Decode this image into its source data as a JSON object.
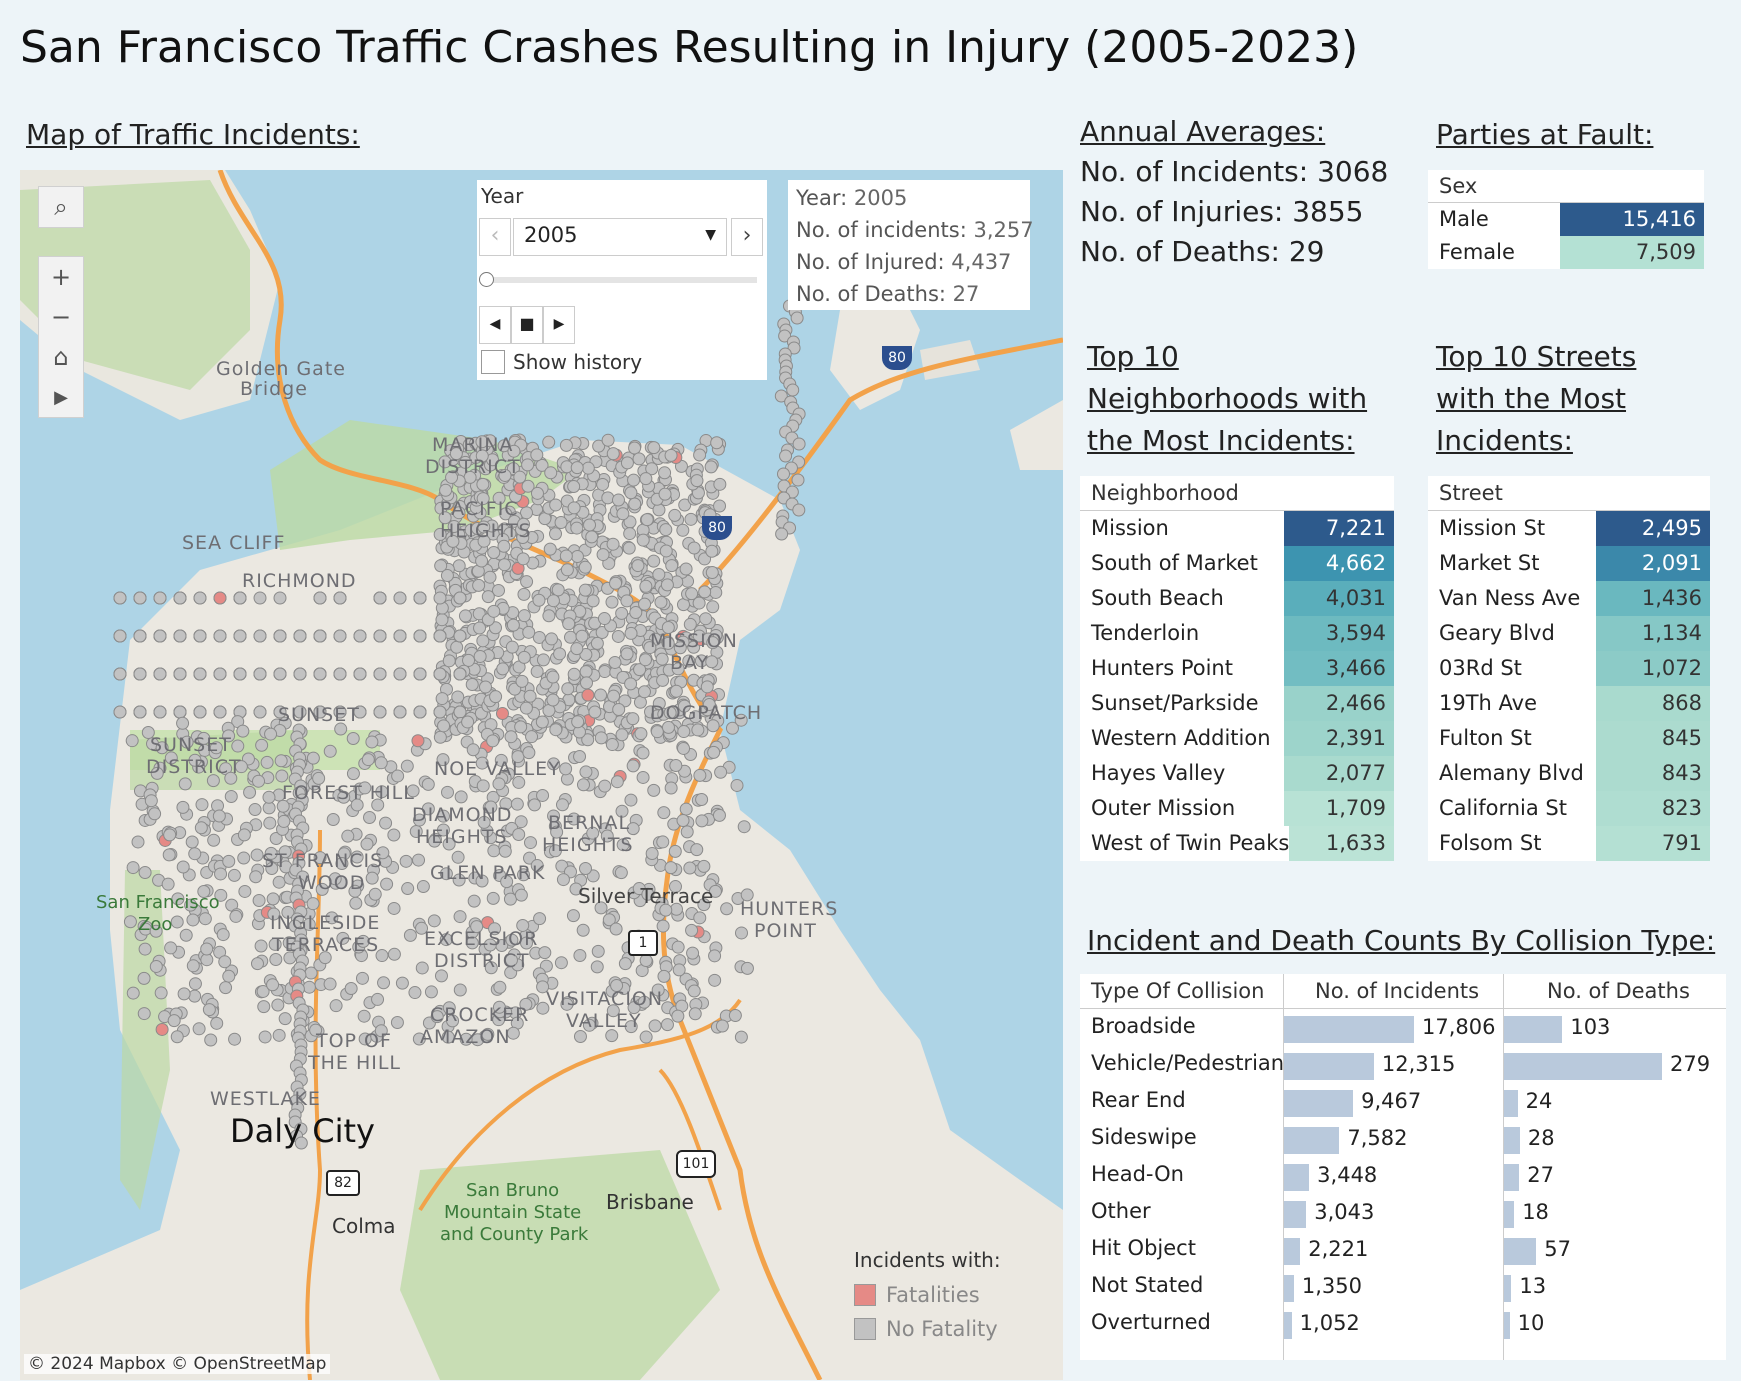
{
  "title": "San Francisco Traffic Crashes Resulting in Injury (2005-2023)",
  "map": {
    "heading": "Map of Traffic Incidents:",
    "tools": [
      "search-icon",
      "zoom-in-icon",
      "zoom-out-icon",
      "home-icon",
      "play-icon"
    ],
    "year_control": {
      "label": "Year",
      "selected": "2005",
      "show_history_label": "Show history"
    },
    "annotation": {
      "year_label": "Year:",
      "year_value": "2005",
      "incidents_label": "No. of incidents:",
      "incidents_value": "3,257",
      "injured_label": "No. of Injured:",
      "injured_value": "4,437",
      "deaths_label": "No. of Deaths:",
      "deaths_value": "27"
    },
    "place_labels": {
      "golden_gate": "Golden Gate",
      "bridge": "Bridge",
      "marina": "MARINA",
      "district": "DISTRICT",
      "pacific": "PACIFIC",
      "heights": "HEIGHTS",
      "sea_cliff": "SEA CLIFF",
      "richmond": "RICHMOND",
      "mission_bay_1": "MISSION",
      "mission_bay_2": "BAY",
      "dogpatch": "DOGPATCH",
      "sunset": "SUNSET",
      "district2": "DISTRICT",
      "noe_valley": "NOE VALLEY",
      "forest_hill": "FOREST HILL",
      "diamond": "DIAMOND",
      "heights2": "HEIGHTS",
      "bernal": "BERNAL",
      "heights3": "HEIGHTS",
      "st_francis": "ST FRANCIS",
      "wood": "WOOD",
      "glen_park": "GLEN PARK",
      "silver_terrace": "Silver Terrace",
      "hunters": "HUNTERS",
      "point": "POINT",
      "ingleside": "INGLESIDE",
      "terraces": "TERRACES",
      "excelsior": "EXCELSIOR",
      "district3": "DISTRICT",
      "visitacion": "VISITACION",
      "valley": "VALLEY",
      "crocker": "CROCKER",
      "amazon": "AMAZON",
      "top_of": "TOP OF",
      "the_hill": "THE HILL",
      "westlake": "WESTLAKE",
      "daly_city": "Daly City",
      "colma": "Colma",
      "brisbane": "Brisbane",
      "san_bruno_1": "San Bruno",
      "san_bruno_2": "Mountain State",
      "san_bruno_3": "and County Park",
      "sf_zoo_1": "San Francisco",
      "sf_zoo_2": "Zoo",
      "hw80": "80",
      "hw101": "101",
      "hw82": "82",
      "hw1": "1"
    },
    "attribution": "© 2024 Mapbox  © OpenStreetMap",
    "legend": {
      "title": "Incidents with:",
      "items": [
        {
          "label": "Fatalities",
          "color": "#e58a86"
        },
        {
          "label": "No Fatality",
          "color": "#c2c2c2"
        }
      ]
    }
  },
  "annual": {
    "heading": "Annual Averages:",
    "incidents": "No. of Incidents: 3068",
    "injuries": "No. of Injuries: 3855",
    "deaths": "No. of Deaths: 29"
  },
  "fault": {
    "heading": "Parties at Fault:",
    "column": "Sex",
    "rows": [
      {
        "name": "Male",
        "value": "15,416",
        "color": "#2d5a8c"
      },
      {
        "name": "Female",
        "value": "7,509",
        "color": "#b4e1d4"
      }
    ]
  },
  "neighborhoods": {
    "heading_1": "Top 10 ",
    "heading_2": "Neighborhoods with ",
    "heading_3": "the Most Incidents:",
    "column": "Neighborhood",
    "rows": [
      {
        "name": "Mission",
        "value": "7,221",
        "color": "#2d5a8c"
      },
      {
        "name": "South of Market",
        "value": "4,662",
        "color": "#3d94b0"
      },
      {
        "name": "South Beach",
        "value": "4,031",
        "color": "#5aaebb"
      },
      {
        "name": "Tenderloin",
        "value": "3,594",
        "color": "#6dbac0"
      },
      {
        "name": "Hunters Point",
        "value": "3,466",
        "color": "#72bdc2"
      },
      {
        "name": "Sunset/Parkside",
        "value": "2,466",
        "color": "#99d2ca"
      },
      {
        "name": "Western Addition",
        "value": "2,391",
        "color": "#9dd4cb"
      },
      {
        "name": "Hayes Valley",
        "value": "2,077",
        "color": "#a9dace"
      },
      {
        "name": "Outer Mission",
        "value": "1,709",
        "color": "#b8e2d5"
      },
      {
        "name": "West of Twin Peaks",
        "value": "1,633",
        "color": "#bbe3d6"
      }
    ]
  },
  "streets": {
    "heading_1": "Top 10 Streets ",
    "heading_2": "with the Most ",
    "heading_3": "Incidents:",
    "column": "Street",
    "rows": [
      {
        "name": "Mission St",
        "value": "2,495",
        "color": "#2d5a8c"
      },
      {
        "name": "Market St",
        "value": "2,091",
        "color": "#3b88aa"
      },
      {
        "name": "Van Ness Ave",
        "value": "1,436",
        "color": "#6ab8bf"
      },
      {
        "name": "Geary Blvd",
        "value": "1,134",
        "color": "#86c8c6"
      },
      {
        "name": "03Rd St",
        "value": "1,072",
        "color": "#8ccbc7"
      },
      {
        "name": "19Th Ave",
        "value": "868",
        "color": "#a9dace"
      },
      {
        "name": "Fulton St",
        "value": "845",
        "color": "#acdbcf"
      },
      {
        "name": "Alemany Blvd",
        "value": "843",
        "color": "#acdbcf"
      },
      {
        "name": "California St",
        "value": "823",
        "color": "#afddd1"
      },
      {
        "name": "Folsom St",
        "value": "791",
        "color": "#b4e0d3"
      }
    ]
  },
  "collision": {
    "heading": "Incident and Death Counts By Collision Type:",
    "col_type": "Type Of Collision",
    "col_incidents": "No. of Incidents",
    "col_deaths": "No. of Deaths",
    "rows": [
      {
        "name": "Broadside",
        "incidents": 17806,
        "incidents_label": "17,806",
        "deaths": 103,
        "deaths_label": "103"
      },
      {
        "name": "Vehicle/Pedestrian",
        "incidents": 12315,
        "incidents_label": "12,315",
        "deaths": 279,
        "deaths_label": "279"
      },
      {
        "name": "Rear End",
        "incidents": 9467,
        "incidents_label": "9,467",
        "deaths": 24,
        "deaths_label": "24"
      },
      {
        "name": "Sideswipe",
        "incidents": 7582,
        "incidents_label": "7,582",
        "deaths": 28,
        "deaths_label": "28"
      },
      {
        "name": "Head-On",
        "incidents": 3448,
        "incidents_label": "3,448",
        "deaths": 27,
        "deaths_label": "27"
      },
      {
        "name": "Other",
        "incidents": 3043,
        "incidents_label": "3,043",
        "deaths": 18,
        "deaths_label": "18"
      },
      {
        "name": "Hit Object",
        "incidents": 2221,
        "incidents_label": "2,221",
        "deaths": 57,
        "deaths_label": "57"
      },
      {
        "name": "Not Stated",
        "incidents": 1350,
        "incidents_label": "1,350",
        "deaths": 13,
        "deaths_label": "13"
      },
      {
        "name": "Overturned",
        "incidents": 1052,
        "incidents_label": "1,052",
        "deaths": 10,
        "deaths_label": "10"
      }
    ]
  }
}
